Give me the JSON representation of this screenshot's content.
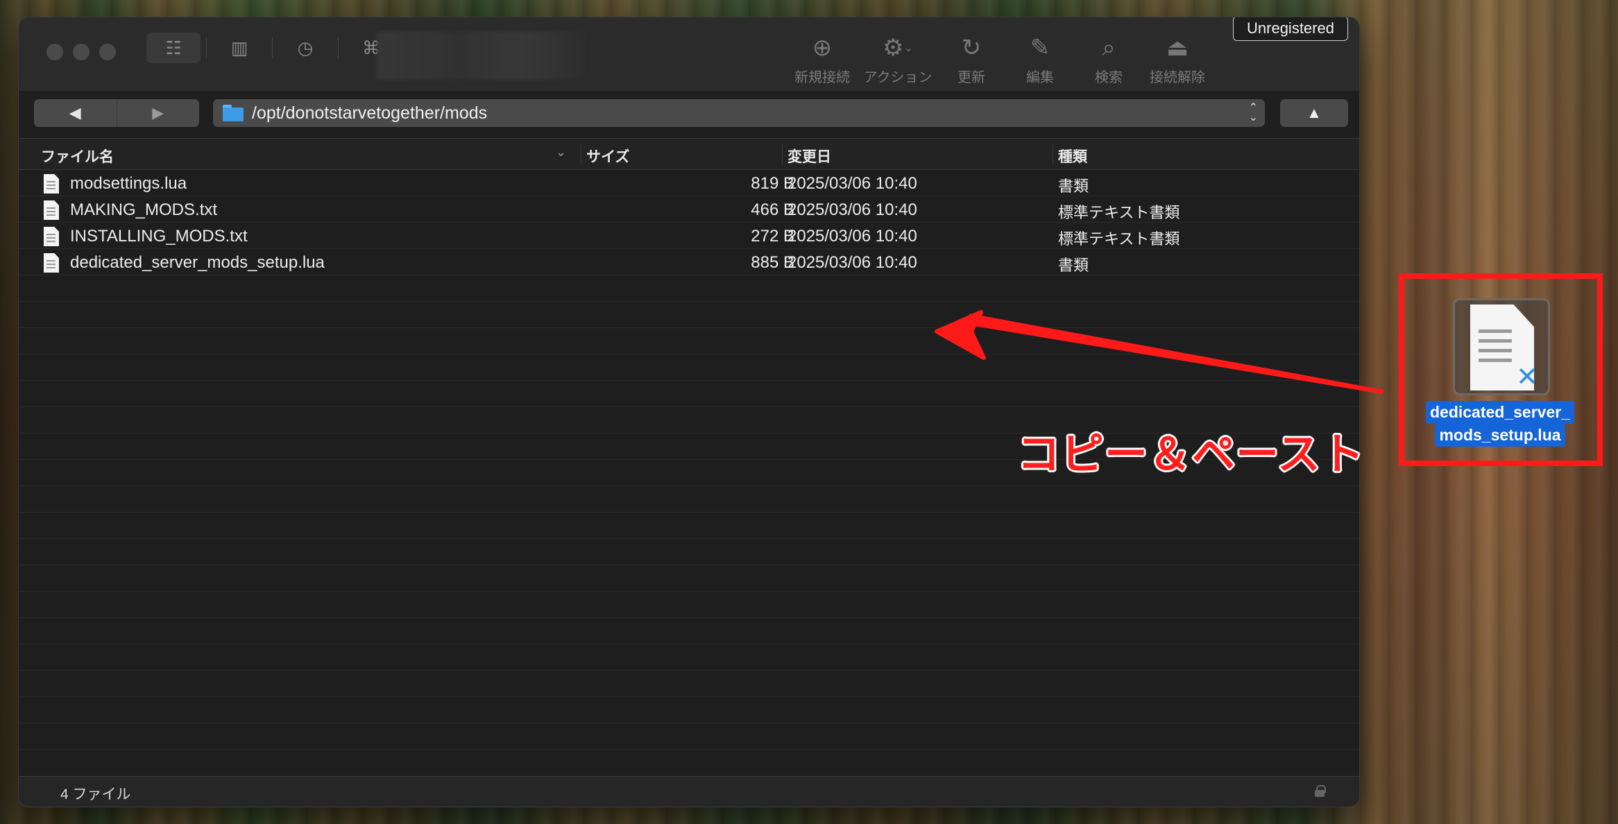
{
  "toolbar": {
    "new_connection": "新規接続",
    "action": "アクション",
    "refresh": "更新",
    "edit": "編集",
    "search": "検索",
    "disconnect": "接続解除",
    "unregistered": "Unregistered"
  },
  "nav": {
    "back": "◀",
    "forward": "▶",
    "path": "/opt/donotstarvetogether/mods",
    "up": "▲"
  },
  "columns": {
    "name": "ファイル名",
    "size": "サイズ",
    "modified": "変更日",
    "kind": "種類"
  },
  "files": [
    {
      "name": "modsettings.lua",
      "size": "819 B",
      "modified": "2025/03/06 10:40",
      "kind": "書類"
    },
    {
      "name": "MAKING_MODS.txt",
      "size": "466 B",
      "modified": "2025/03/06 10:40",
      "kind": "標準テキスト書類"
    },
    {
      "name": "INSTALLING_MODS.txt",
      "size": "272 B",
      "modified": "2025/03/06 10:40",
      "kind": "標準テキスト書類"
    },
    {
      "name": "dedicated_server_mods_setup.lua",
      "size": "885 B",
      "modified": "2025/03/06 10:40",
      "kind": "書類"
    }
  ],
  "status": {
    "count": "4 ファイル"
  },
  "annotation": {
    "label": "コピー＆ペースト",
    "color": "#ff1a1a"
  },
  "desktop_file": {
    "line1": "dedicated_server_",
    "line2": "mods_setup.lua"
  }
}
